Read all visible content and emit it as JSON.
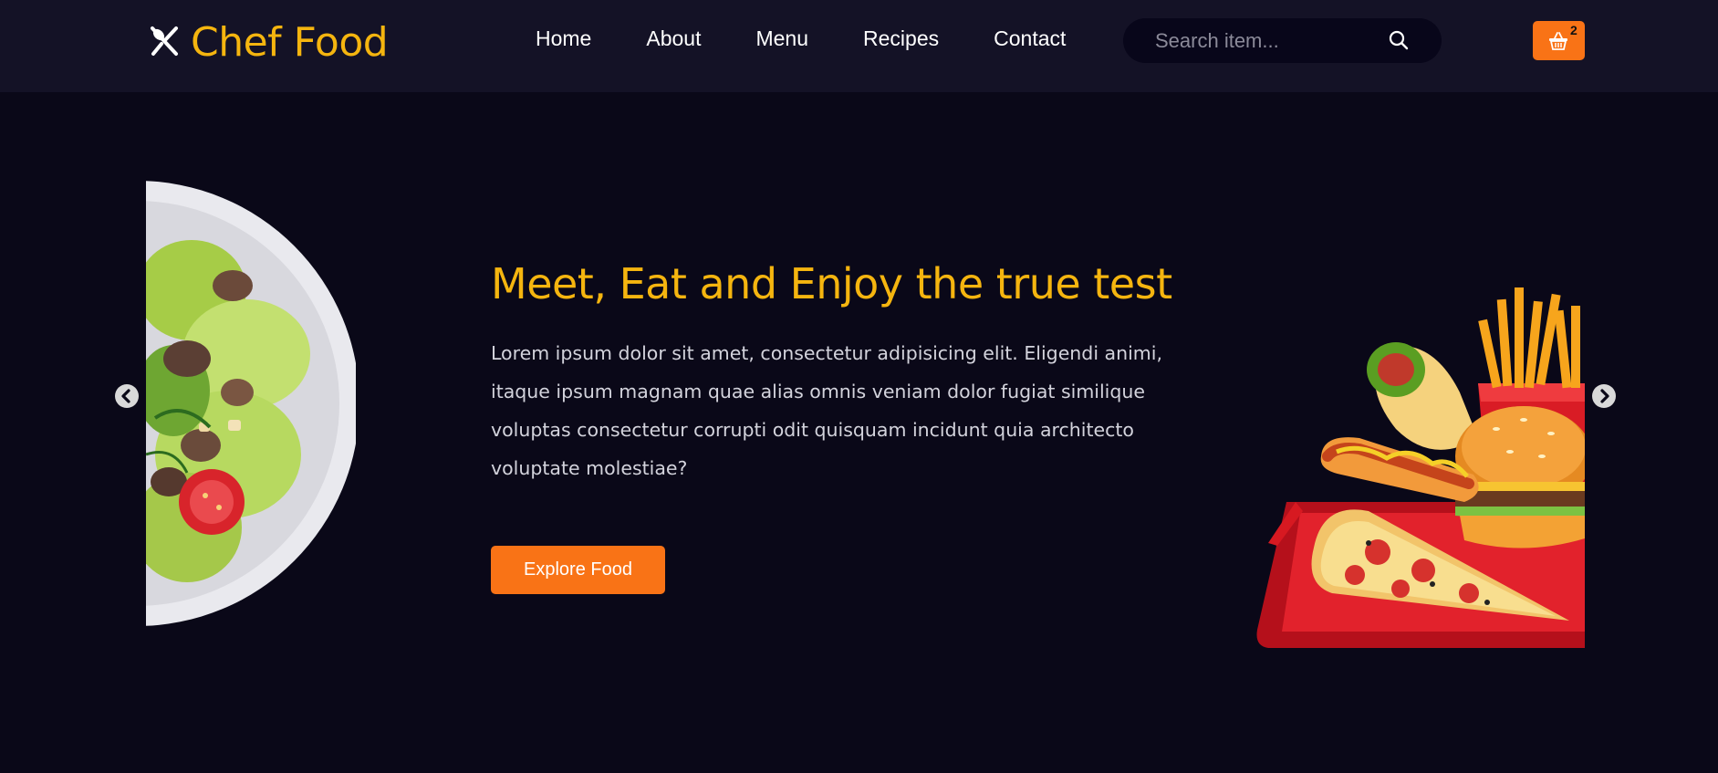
{
  "brand": {
    "name": "Chef Food",
    "accent_color": "#f5b50f",
    "icon": "fork-knife-icon"
  },
  "nav": {
    "items": [
      {
        "label": "Home"
      },
      {
        "label": "About"
      },
      {
        "label": "Menu"
      },
      {
        "label": "Recipes"
      },
      {
        "label": "Contact"
      }
    ]
  },
  "search": {
    "placeholder": "Search item...",
    "value": "",
    "icon": "search-icon"
  },
  "cart": {
    "count": "2",
    "icon": "shopping-basket-icon",
    "color": "#f97316"
  },
  "hero": {
    "title": "Meet, Eat and Enjoy the true test",
    "description": "Lorem ipsum dolor sit amet, consectetur adipisicing elit. Eligendi animi, itaque ipsum magnam quae alias omnis veniam dolor fugiat similique voluptas consectetur corrupti odit quisquam incidunt quia architecto voluptate molestiae?",
    "button_label": "Explore Food",
    "left_image": "salad-plate-image",
    "right_image": "fast-food-tray-image"
  },
  "carousel": {
    "prev_icon": "chevron-left-icon",
    "next_icon": "chevron-right-icon"
  },
  "colors": {
    "background": "#0a0818",
    "navbar": "#141226",
    "button": "#f97316"
  }
}
